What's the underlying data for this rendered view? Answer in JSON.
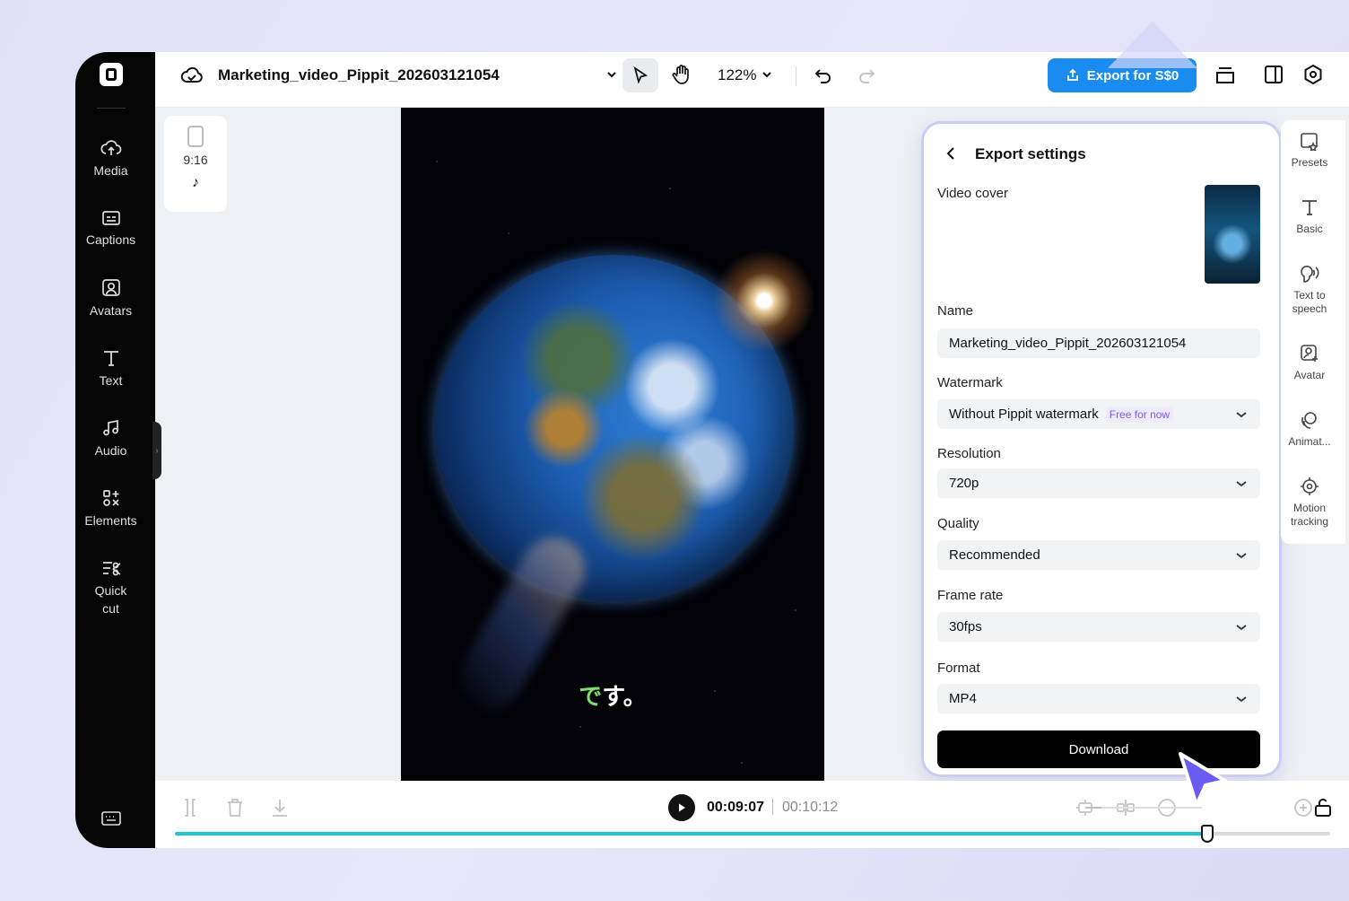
{
  "project": {
    "title": "Marketing_video_Pippit_202603121054"
  },
  "sidebar": {
    "items": [
      {
        "label": "Media",
        "icon": "cloud-upload-icon"
      },
      {
        "label": "Captions",
        "icon": "captions-icon"
      },
      {
        "label": "Avatars",
        "icon": "avatar-icon"
      },
      {
        "label": "Text",
        "icon": "text-icon"
      },
      {
        "label": "Audio",
        "icon": "music-icon"
      },
      {
        "label": "Elements",
        "icon": "elements-icon"
      },
      {
        "label": "Quick",
        "label2": "cut",
        "icon": "quick-cut-icon"
      }
    ]
  },
  "toolbar": {
    "zoom": "122%",
    "export_label": "Export for S$0"
  },
  "ratio": {
    "label": "9:16"
  },
  "canvas": {
    "subtitle_highlight": "で",
    "subtitle_rest": "す。"
  },
  "export_panel": {
    "title": "Export settings",
    "video_cover_label": "Video cover",
    "name_label": "Name",
    "name_value": "Marketing_video_Pippit_202603121054",
    "watermark_label": "Watermark",
    "watermark_value": "Without Pippit watermark",
    "watermark_badge": "Free for now",
    "resolution_label": "Resolution",
    "resolution_value": "720p",
    "quality_label": "Quality",
    "quality_value": "Recommended",
    "framerate_label": "Frame rate",
    "framerate_value": "30fps",
    "format_label": "Format",
    "format_value": "MP4",
    "download_label": "Download"
  },
  "right_rail": {
    "items": [
      {
        "label": "Presets",
        "icon": "presets-icon"
      },
      {
        "label": "Basic",
        "icon": "text-icon"
      },
      {
        "label": "Text to",
        "label2": "speech",
        "icon": "speech-icon"
      },
      {
        "label": "Avatar",
        "icon": "avatar-icon"
      },
      {
        "label": "Animat...",
        "icon": "animation-icon"
      },
      {
        "label": "Motion",
        "label2": "tracking",
        "icon": "motion-tracking-icon"
      }
    ]
  },
  "playback": {
    "current_time": "00:09:07",
    "total_time": "00:10:12",
    "progress_fraction": 0.894
  },
  "colors": {
    "accent": "#1a8cf0",
    "progress": "#1fc4d6",
    "cursor": "#6a5cf0"
  }
}
